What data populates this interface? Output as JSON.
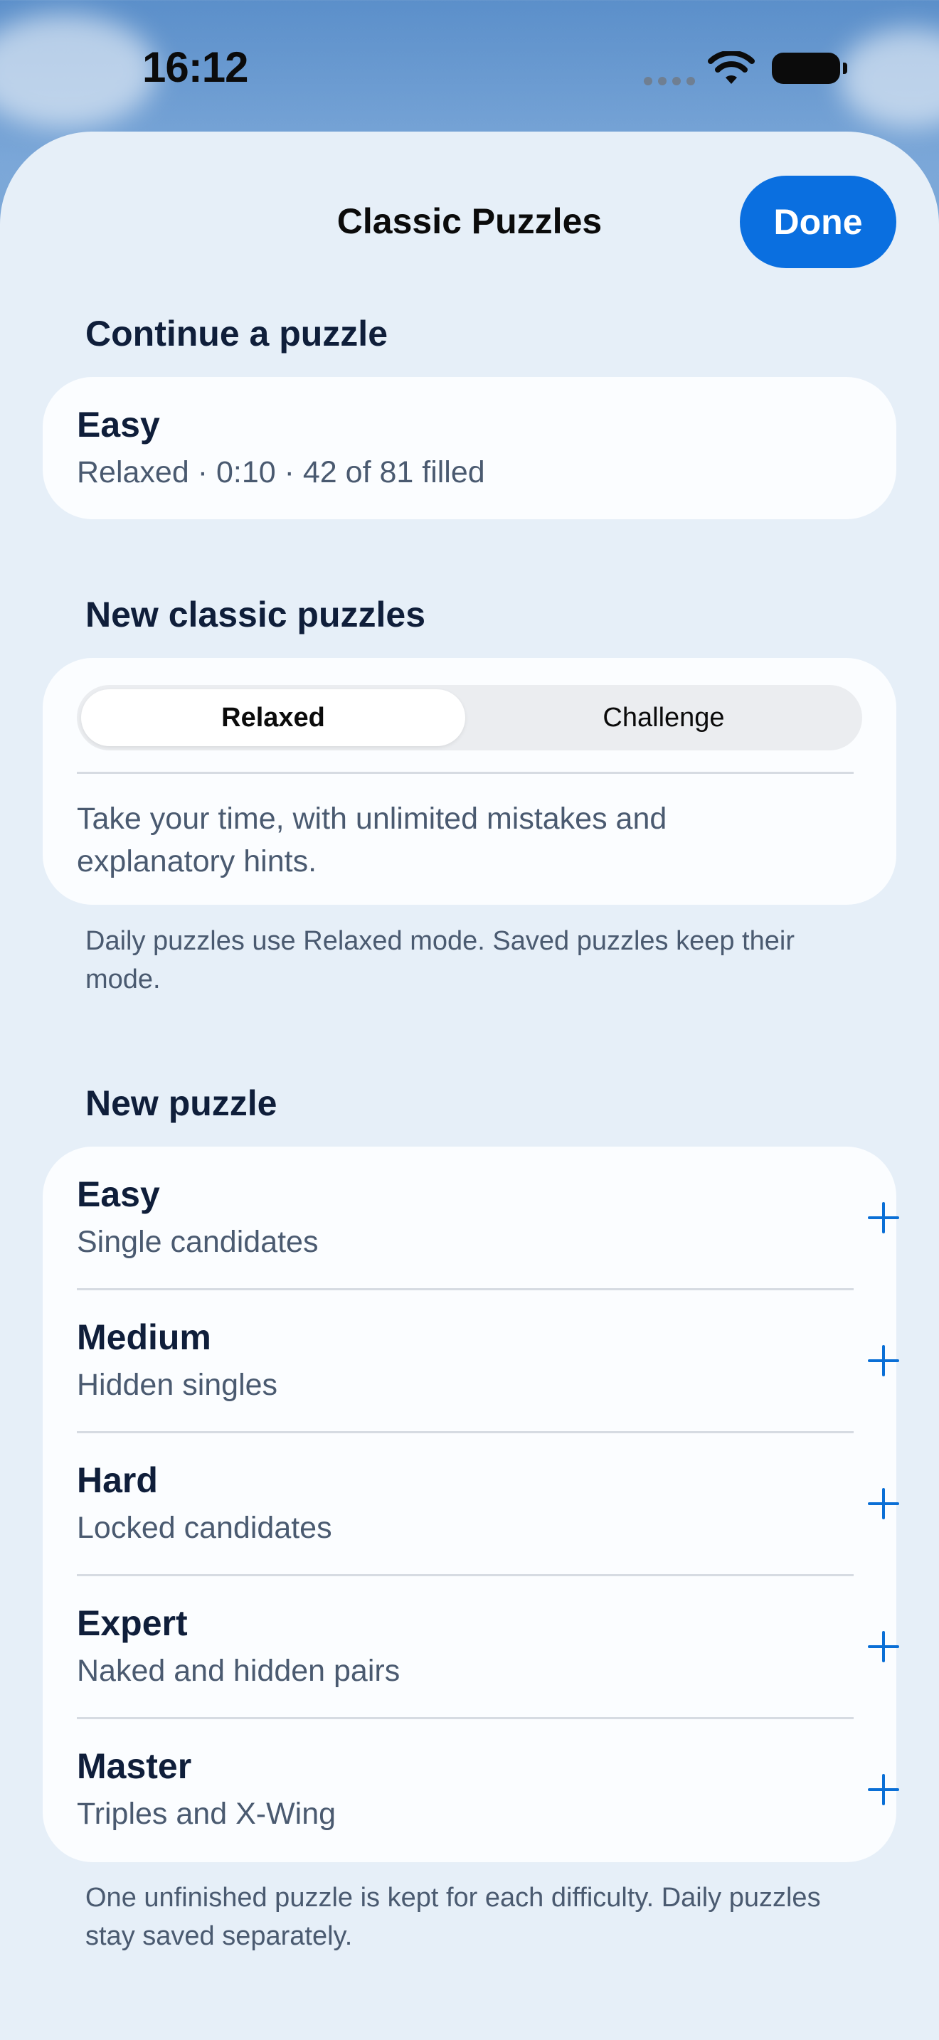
{
  "status_bar": {
    "time": "16:12"
  },
  "header": {
    "title": "Classic Puzzles",
    "done_label": "Done"
  },
  "continue_section": {
    "header": "Continue a puzzle",
    "item": {
      "title": "Easy",
      "subtitle": "Relaxed · 0:10 · 42 of 81 filled"
    }
  },
  "classic_section": {
    "header": "New classic puzzles",
    "segments": [
      {
        "label": "Relaxed",
        "selected": true
      },
      {
        "label": "Challenge",
        "selected": false
      }
    ],
    "description": "Take your time, with unlimited mistakes and explanatory hints.",
    "footnote": "Daily puzzles use Relaxed mode. Saved puzzles keep their mode."
  },
  "new_puzzle_section": {
    "header": "New puzzle",
    "items": [
      {
        "title": "Easy",
        "subtitle": "Single candidates"
      },
      {
        "title": "Medium",
        "subtitle": "Hidden singles"
      },
      {
        "title": "Hard",
        "subtitle": "Locked candidates"
      },
      {
        "title": "Expert",
        "subtitle": "Naked and hidden pairs"
      },
      {
        "title": "Master",
        "subtitle": "Triples and X-Wing"
      }
    ],
    "footnote": "One unfinished puzzle is kept for each difficulty. Daily puzzles stay saved separately."
  },
  "colors": {
    "accent": "#0a6fe0",
    "sheet": "#e6eff8",
    "card": "#fbfdff",
    "text": "#0f1e3a",
    "secondary_text": "#4a5a70"
  }
}
